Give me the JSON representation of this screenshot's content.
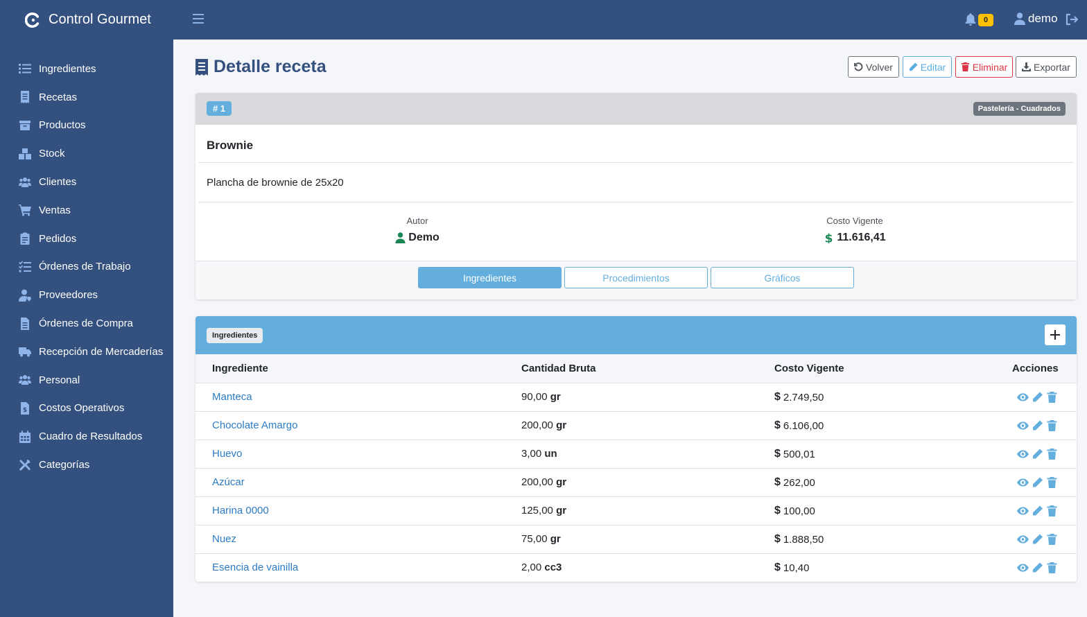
{
  "app": {
    "brand": "Control Gourmet"
  },
  "colors": {
    "sidebar": "#34507e",
    "accent": "#63aedc",
    "danger": "#dc3545",
    "success": "#198754",
    "warning": "#ffc107"
  },
  "sidebar": {
    "items": [
      {
        "label": "Ingredientes",
        "icon": "list-icon"
      },
      {
        "label": "Recetas",
        "icon": "receipt-icon"
      },
      {
        "label": "Productos",
        "icon": "box-icon"
      },
      {
        "label": "Stock",
        "icon": "boxes-icon"
      },
      {
        "label": "Clientes",
        "icon": "users-icon"
      },
      {
        "label": "Ventas",
        "icon": "cart-icon"
      },
      {
        "label": "Pedidos",
        "icon": "clipboard-icon"
      },
      {
        "label": "Órdenes de Trabajo",
        "icon": "tasks-icon"
      },
      {
        "label": "Proveedores",
        "icon": "user-tie-icon"
      },
      {
        "label": "Órdenes de Compra",
        "icon": "file-icon"
      },
      {
        "label": "Recepción de Mercaderías",
        "icon": "truck-icon"
      },
      {
        "label": "Personal",
        "icon": "people-icon"
      },
      {
        "label": "Costos Operativos",
        "icon": "invoice-dollar-icon"
      },
      {
        "label": "Cuadro de Resultados",
        "icon": "calendar-icon"
      },
      {
        "label": "Categorías",
        "icon": "tools-icon"
      }
    ]
  },
  "topbar": {
    "notifications": "0",
    "user": "demo"
  },
  "page": {
    "title": "Detalle receta",
    "buttons": {
      "back": "Volver",
      "edit": "Editar",
      "delete": "Eliminar",
      "export": "Exportar"
    }
  },
  "recipe": {
    "id": "# 1",
    "category": "Pastelería - Cuadrados",
    "name": "Brownie",
    "description": "Plancha de brownie de 25x20",
    "author_label": "Autor",
    "author": "Demo",
    "cost_label": "Costo Vigente",
    "cost": "11.616,41"
  },
  "tabs": [
    "Ingredientes",
    "Procedimientos",
    "Gráficos"
  ],
  "ingredients": {
    "badge": "Ingredientes",
    "columns": [
      "Ingrediente",
      "Cantidad Bruta",
      "Costo Vigente",
      "Acciones"
    ],
    "rows": [
      {
        "name": "Manteca",
        "qty": "90,00",
        "unit": "gr",
        "cost": "2.749,50"
      },
      {
        "name": "Chocolate Amargo",
        "qty": "200,00",
        "unit": "gr",
        "cost": "6.106,00"
      },
      {
        "name": "Huevo",
        "qty": "3,00",
        "unit": "un",
        "cost": "500,01"
      },
      {
        "name": "Azúcar",
        "qty": "200,00",
        "unit": "gr",
        "cost": "262,00"
      },
      {
        "name": "Harina 0000",
        "qty": "125,00",
        "unit": "gr",
        "cost": "100,00"
      },
      {
        "name": "Nuez",
        "qty": "75,00",
        "unit": "gr",
        "cost": "1.888,50"
      },
      {
        "name": "Esencia de vainilla",
        "qty": "2,00",
        "unit": "cc3",
        "cost": "10,40"
      }
    ]
  }
}
